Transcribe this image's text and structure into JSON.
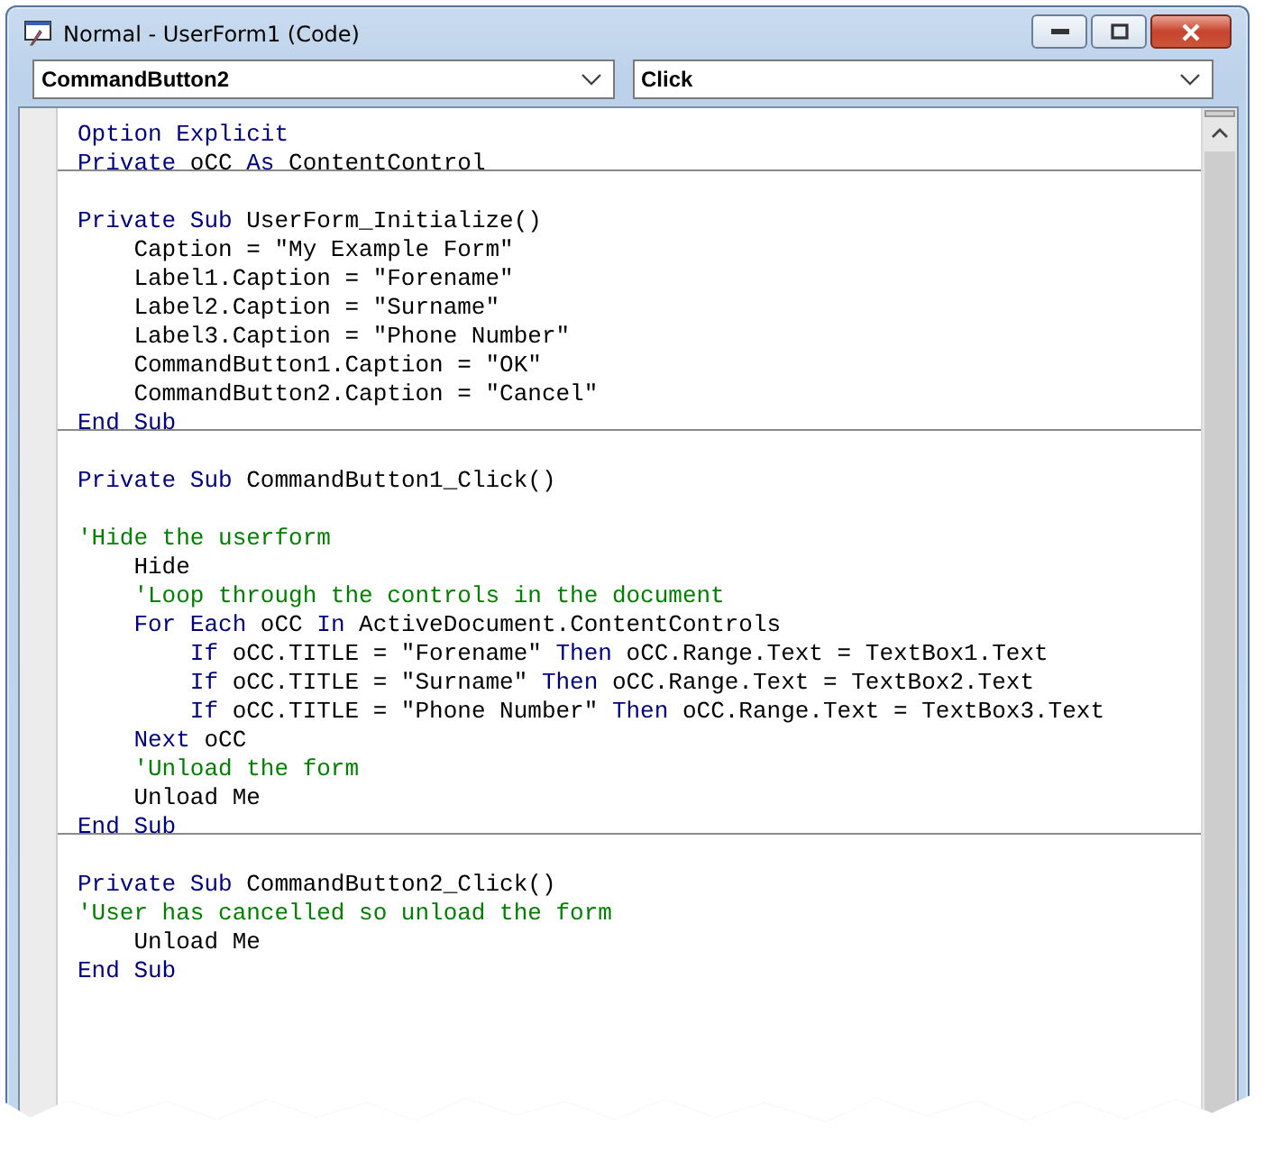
{
  "window": {
    "title": "Normal - UserForm1 (Code)"
  },
  "object_dropdown": {
    "value": "CommandButton2"
  },
  "procedure_dropdown": {
    "value": "Click"
  },
  "code": {
    "procedures": [
      {
        "lines": [
          {
            "kind": "code",
            "segments": [
              {
                "kind": "keyword",
                "text": "Option Explicit"
              }
            ]
          },
          {
            "kind": "code",
            "segments": [
              {
                "kind": "keyword",
                "text": "Private"
              },
              {
                "kind": "plain",
                "text": " oCC "
              },
              {
                "kind": "keyword",
                "text": "As"
              },
              {
                "kind": "plain",
                "text": " ContentControl"
              }
            ]
          }
        ]
      },
      {
        "lines": [
          {
            "kind": "blank"
          },
          {
            "kind": "code",
            "segments": [
              {
                "kind": "keyword",
                "text": "Private Sub"
              },
              {
                "kind": "plain",
                "text": " UserForm_Initialize()"
              }
            ]
          },
          {
            "kind": "code",
            "segments": [
              {
                "kind": "plain",
                "text": "    Caption = \"My Example Form\""
              }
            ]
          },
          {
            "kind": "code",
            "segments": [
              {
                "kind": "plain",
                "text": "    Label1.Caption = \"Forename\""
              }
            ]
          },
          {
            "kind": "code",
            "segments": [
              {
                "kind": "plain",
                "text": "    Label2.Caption = \"Surname\""
              }
            ]
          },
          {
            "kind": "code",
            "segments": [
              {
                "kind": "plain",
                "text": "    Label3.Caption = \"Phone Number\""
              }
            ]
          },
          {
            "kind": "code",
            "segments": [
              {
                "kind": "plain",
                "text": "    CommandButton1.Caption = \"OK\""
              }
            ]
          },
          {
            "kind": "code",
            "segments": [
              {
                "kind": "plain",
                "text": "    CommandButton2.Caption = \"Cancel\""
              }
            ]
          },
          {
            "kind": "code",
            "segments": [
              {
                "kind": "keyword",
                "text": "End Sub"
              }
            ]
          }
        ]
      },
      {
        "lines": [
          {
            "kind": "blank"
          },
          {
            "kind": "code",
            "segments": [
              {
                "kind": "keyword",
                "text": "Private Sub"
              },
              {
                "kind": "plain",
                "text": " CommandButton1_Click()"
              }
            ]
          },
          {
            "kind": "blank"
          },
          {
            "kind": "code",
            "segments": [
              {
                "kind": "comment",
                "text": "'Hide the userform"
              }
            ]
          },
          {
            "kind": "code",
            "segments": [
              {
                "kind": "plain",
                "text": "    Hide"
              }
            ]
          },
          {
            "kind": "code",
            "segments": [
              {
                "kind": "comment",
                "text": "    'Loop through the controls in the document"
              }
            ]
          },
          {
            "kind": "code",
            "segments": [
              {
                "kind": "keyword",
                "text": "    For Each"
              },
              {
                "kind": "plain",
                "text": " oCC "
              },
              {
                "kind": "keyword",
                "text": "In"
              },
              {
                "kind": "plain",
                "text": " ActiveDocument.ContentControls"
              }
            ]
          },
          {
            "kind": "code",
            "segments": [
              {
                "kind": "keyword",
                "text": "        If"
              },
              {
                "kind": "plain",
                "text": " oCC.TITLE = \"Forename\" "
              },
              {
                "kind": "keyword",
                "text": "Then"
              },
              {
                "kind": "plain",
                "text": " oCC.Range.Text = TextBox1.Text"
              }
            ]
          },
          {
            "kind": "code",
            "segments": [
              {
                "kind": "keyword",
                "text": "        If"
              },
              {
                "kind": "plain",
                "text": " oCC.TITLE = \"Surname\" "
              },
              {
                "kind": "keyword",
                "text": "Then"
              },
              {
                "kind": "plain",
                "text": " oCC.Range.Text = TextBox2.Text"
              }
            ]
          },
          {
            "kind": "code",
            "segments": [
              {
                "kind": "keyword",
                "text": "        If"
              },
              {
                "kind": "plain",
                "text": " oCC.TITLE = \"Phone Number\" "
              },
              {
                "kind": "keyword",
                "text": "Then"
              },
              {
                "kind": "plain",
                "text": " oCC.Range.Text = TextBox3.Text"
              }
            ]
          },
          {
            "kind": "code",
            "segments": [
              {
                "kind": "keyword",
                "text": "    Next"
              },
              {
                "kind": "plain",
                "text": " oCC"
              }
            ]
          },
          {
            "kind": "code",
            "segments": [
              {
                "kind": "comment",
                "text": "    'Unload the form"
              }
            ]
          },
          {
            "kind": "code",
            "segments": [
              {
                "kind": "plain",
                "text": "    Unload Me"
              }
            ]
          },
          {
            "kind": "code",
            "segments": [
              {
                "kind": "keyword",
                "text": "End Sub"
              }
            ]
          }
        ]
      },
      {
        "lines": [
          {
            "kind": "blank"
          },
          {
            "kind": "code",
            "segments": [
              {
                "kind": "keyword",
                "text": "Private Sub"
              },
              {
                "kind": "plain",
                "text": " CommandButton2_Click()"
              }
            ]
          },
          {
            "kind": "code",
            "segments": [
              {
                "kind": "comment",
                "text": "'User has cancelled so unload the form"
              }
            ]
          },
          {
            "kind": "code",
            "segments": [
              {
                "kind": "plain",
                "text": "    Unload Me"
              }
            ]
          },
          {
            "kind": "code",
            "segments": [
              {
                "kind": "keyword",
                "text": "End Sub"
              }
            ]
          }
        ]
      }
    ]
  }
}
